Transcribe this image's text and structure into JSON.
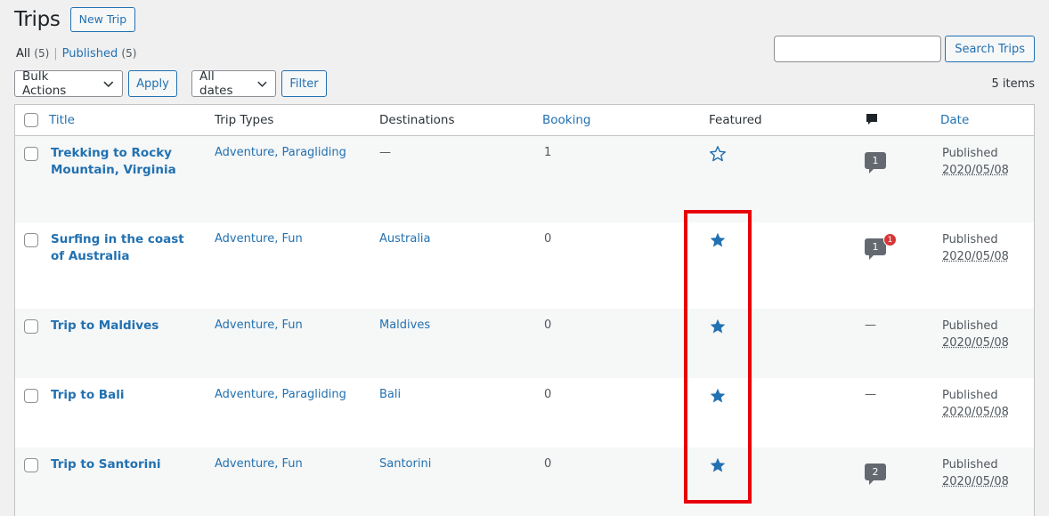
{
  "page": {
    "title": "Trips",
    "new_button": "New Trip"
  },
  "views": {
    "all_label": "All",
    "all_count": "(5)",
    "separator": "|",
    "published_label": "Published",
    "published_count": "(5)"
  },
  "search": {
    "value": "",
    "button": "Search Trips"
  },
  "tablenav": {
    "bulk_actions": "Bulk Actions",
    "apply": "Apply",
    "dates": "All dates",
    "filter": "Filter",
    "items_count": "5 items"
  },
  "columns": {
    "title": "Title",
    "trip_types": "Trip Types",
    "destinations": "Destinations",
    "booking": "Booking",
    "featured": "Featured",
    "comments_icon": "comment-icon",
    "date": "Date"
  },
  "rows": [
    {
      "title": "Trekking to Rocky Mountain, Virginia",
      "trip_types": "Adventure, Paragliding",
      "destination": "—",
      "booking": "1",
      "featured": false,
      "comments": "1",
      "pending": "",
      "status": "Published",
      "date": "2020/05/08"
    },
    {
      "title": "Surfing in the coast of Australia",
      "trip_types": "Adventure, Fun",
      "destination": "Australia",
      "booking": "0",
      "featured": true,
      "comments": "1",
      "pending": "1",
      "status": "Published",
      "date": "2020/05/08"
    },
    {
      "title": "Trip to Maldives",
      "trip_types": "Adventure, Fun",
      "destination": "Maldives",
      "booking": "0",
      "featured": true,
      "comments": "—",
      "pending": "",
      "status": "Published",
      "date": "2020/05/08"
    },
    {
      "title": "Trip to Bali",
      "trip_types": "Adventure, Paragliding",
      "destination": "Bali",
      "booking": "0",
      "featured": true,
      "comments": "—",
      "pending": "",
      "status": "Published",
      "date": "2020/05/08"
    },
    {
      "title": "Trip to Santorini",
      "trip_types": "Adventure, Fun",
      "destination": "Santorini",
      "booking": "0",
      "featured": true,
      "comments": "2",
      "pending": "",
      "status": "Published",
      "date": "2020/05/08"
    }
  ],
  "colors": {
    "link": "#2271b1",
    "star": "#2271b1",
    "bubble": "#646970",
    "pending_badge": "#d63638",
    "highlight": "#e8000b"
  }
}
